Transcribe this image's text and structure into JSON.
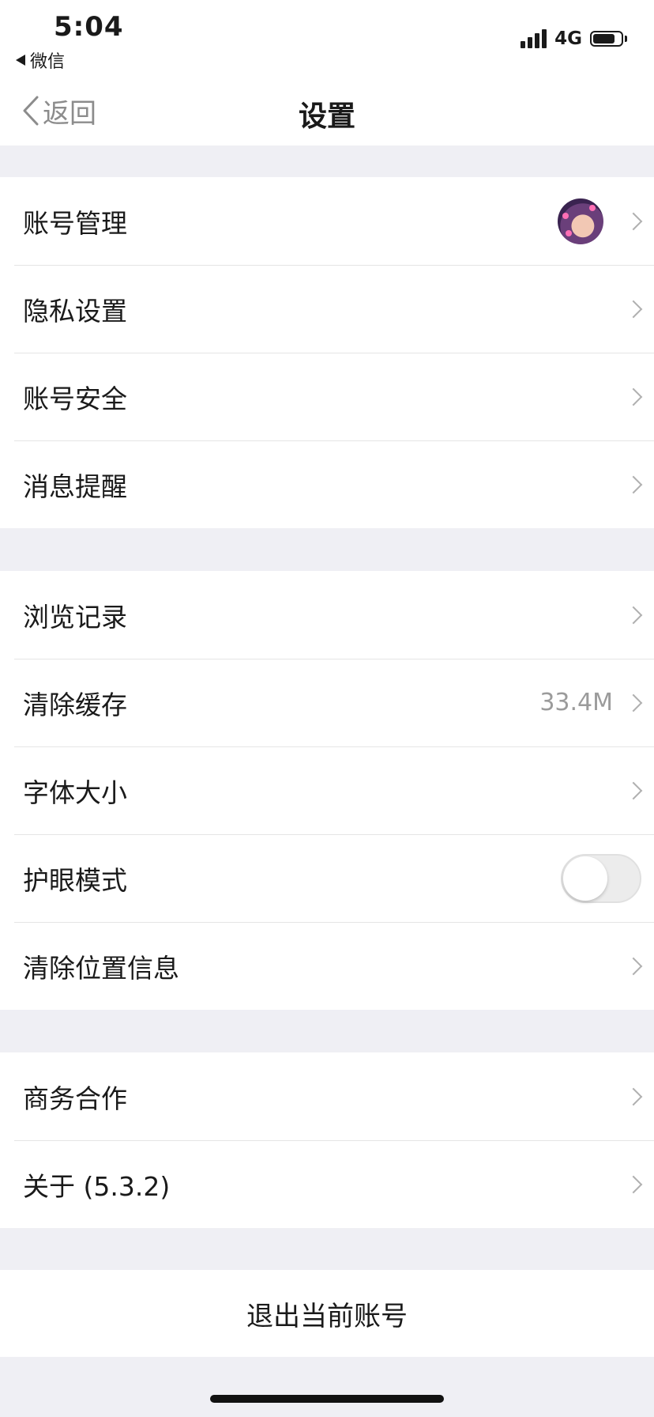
{
  "status_bar": {
    "time": "5:04",
    "back_app": "微信",
    "network": "4G",
    "signal_bars": 4,
    "battery_fraction": 0.8
  },
  "nav": {
    "back_label": "返回",
    "title": "设置"
  },
  "groups": [
    {
      "items": [
        {
          "label": "账号管理",
          "trailing": "avatar"
        },
        {
          "label": "隐私设置",
          "trailing": "chevron"
        },
        {
          "label": "账号安全",
          "trailing": "chevron"
        },
        {
          "label": "消息提醒",
          "trailing": "chevron"
        }
      ]
    },
    {
      "items": [
        {
          "label": "浏览记录",
          "trailing": "chevron"
        },
        {
          "label": "清除缓存",
          "trailing": "chevron",
          "value": "33.4M"
        },
        {
          "label": "字体大小",
          "trailing": "chevron"
        },
        {
          "label": "护眼模式",
          "trailing": "toggle",
          "toggle_on": false
        },
        {
          "label": "清除位置信息",
          "trailing": "chevron"
        }
      ]
    },
    {
      "items": [
        {
          "label": "商务合作",
          "trailing": "chevron"
        },
        {
          "label": "关于 (5.3.2)",
          "trailing": "chevron"
        }
      ]
    }
  ],
  "logout_label": "退出当前账号",
  "colors": {
    "background": "#efeff4",
    "card": "#ffffff",
    "text": "#1a1a1a",
    "secondary_text": "#9b9b9b",
    "chevron": "#b0b0b0"
  }
}
